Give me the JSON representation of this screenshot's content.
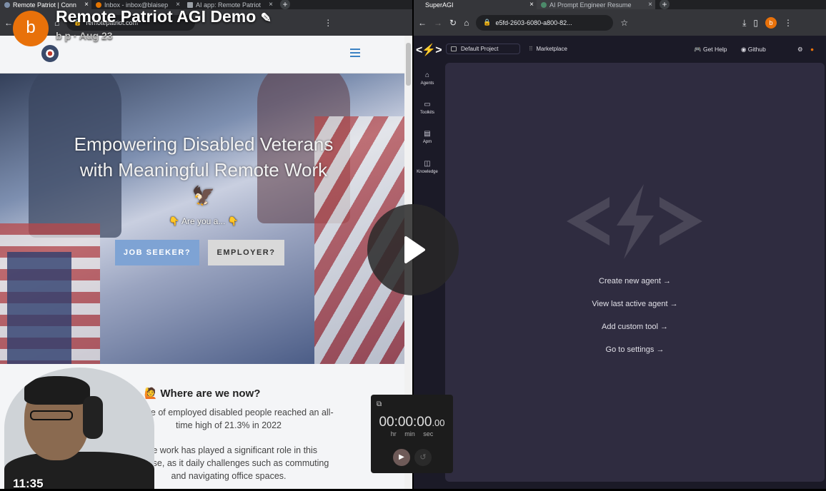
{
  "left_browser": {
    "tabs": [
      {
        "label": "Remote Patriot | Conn",
        "active": true
      },
      {
        "label": "Inbox - inbox@blaisep",
        "active": false
      },
      {
        "label": "AI app: Remote Patriot",
        "active": false
      }
    ],
    "new_tab": "+",
    "url": "remotepatriot.com"
  },
  "right_browser": {
    "tabs": [
      {
        "label": "SuperAGI",
        "active": true
      },
      {
        "label": "AI Prompt Engineer Resume",
        "active": false
      }
    ],
    "new_tab": "+",
    "url": "e5fd-2603-6080-a800-82..."
  },
  "profile_initial": "b",
  "site": {
    "hero_title": "Empowering Disabled Veterans with Meaningful Remote Work 🦅",
    "hero_sub": "👇 Are you a... 👇",
    "job_seeker_btn": "JOB SEEKER?",
    "employer_btn": "EMPLOYER?",
    "section_title": "🙋 Where are we now?",
    "para1": "centage of employed disabled people reached an all-time high of 21.3% in 2022",
    "para2": "note work has played a significant role in this increase, as it daily challenges such as commuting and navigating office spaces."
  },
  "superagi": {
    "logo": "<⚡>",
    "project": "Default Project",
    "marketplace": "Marketplace",
    "get_help": "Get Help",
    "github": "Github",
    "sidebar": [
      "Agents",
      "Toolkits",
      "Apm",
      "Knowledge"
    ],
    "links": [
      "Create new agent →",
      "View last active agent →",
      "Add custom tool →",
      "Go to settings →"
    ]
  },
  "video": {
    "avatar": "b",
    "title": "Remote Patriot AGI Demo",
    "meta": "b p · Aug 23",
    "timestamp": "11:35"
  },
  "timer": {
    "digits": "00:00:00",
    "fraction": ".00",
    "labels": "hr min sec"
  }
}
